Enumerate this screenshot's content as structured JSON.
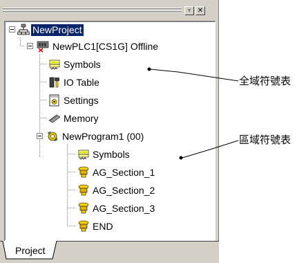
{
  "toolbar": {
    "dropdown_glyph": "▾",
    "close_glyph": "✕"
  },
  "tree": {
    "root": {
      "label": "NewProject",
      "icon": "network-icon",
      "selected": true
    },
    "plc": {
      "label": "NewPLC1[CS1G] Offline",
      "icon": "plc-icon"
    },
    "plc_children": [
      {
        "label": "Symbols",
        "icon": "symbols-icon"
      },
      {
        "label": "IO Table",
        "icon": "io-table-icon"
      },
      {
        "label": "Settings",
        "icon": "settings-icon"
      },
      {
        "label": "Memory",
        "icon": "memory-icon"
      }
    ],
    "program": {
      "label": "NewProgram1 (00)",
      "icon": "program-icon"
    },
    "program_children": [
      {
        "label": "Symbols",
        "icon": "symbols-icon"
      },
      {
        "label": "AG_Section_1",
        "icon": "section-icon"
      },
      {
        "label": "AG_Section_2",
        "icon": "section-icon"
      },
      {
        "label": "AG_Section_3",
        "icon": "section-icon"
      },
      {
        "label": "END",
        "icon": "section-icon"
      }
    ]
  },
  "tabs": [
    {
      "label": "Project",
      "active": true
    }
  ],
  "annotations": {
    "global_symbols": "全域符號表",
    "local_symbols": "區域符號表"
  },
  "colors": {
    "panel": "#d4d0c8",
    "selection": "#0a246a",
    "tree_line": "#808080"
  }
}
